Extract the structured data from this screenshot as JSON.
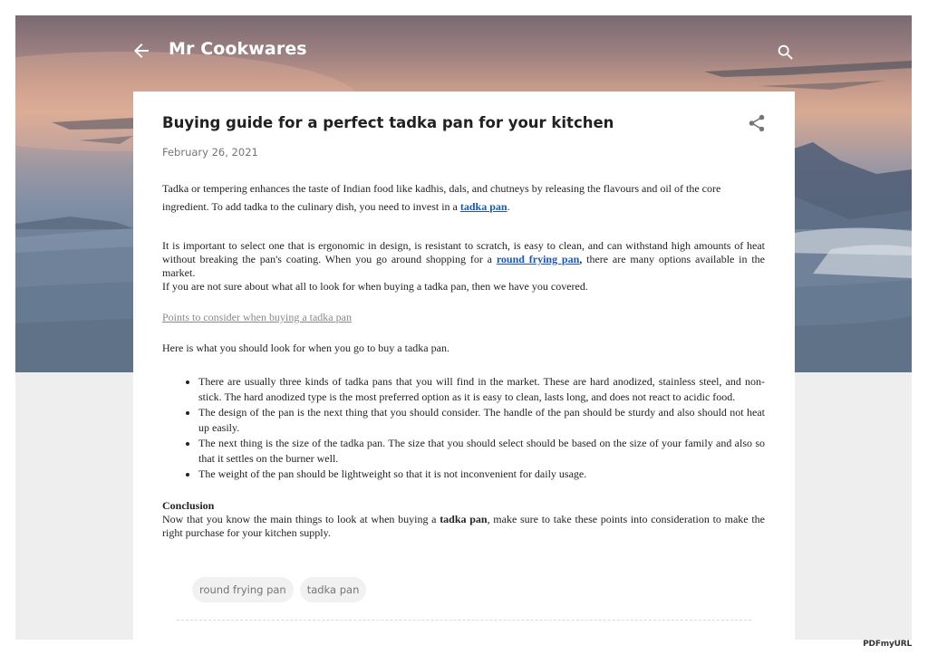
{
  "header": {
    "site_title": "Mr Cookwares",
    "icons": {
      "back": "arrow-left-icon",
      "search": "search-icon"
    }
  },
  "post": {
    "title": "Buying guide for a perfect tadka pan for your kitchen",
    "date": "February 26, 2021",
    "share_icon": "share-icon",
    "p1": {
      "text": "Tadka or tempering enhances the taste of Indian food like kadhis, dals, and chutneys by releasing the flavours and oil of the core ingredient. To add tadka to the culinary dish, you need to invest in a ",
      "link": "tadka pan",
      "end": "."
    },
    "p2": {
      "text": "It is important to select one that is ergonomic in design, is resistant to scratch, is easy to clean, and can withstand high amounts of heat without breaking the pan's coating. When you go around shopping for a ",
      "link": "round frying pan",
      "bold_comma": ",",
      "end": " there are many options available in the market."
    },
    "p3": "If you are not sure about what all to look for when buying a tadka pan, then we have you covered.",
    "subheading": "Points to consider when buying a tadka pan",
    "intro": "Here is what you should look for when you go to buy a tadka pan.",
    "bullets": [
      "There are usually three kinds of tadka pans that you will find in the market. These are hard anodized, stainless steel, and non-stick. The hard anodized type is the most preferred option as it is easy to clean, lasts long, and does not react to acidic food.",
      "The design of the pan is the next thing that you should consider. The handle of the pan should be sturdy and also should not heat up easily.",
      "The next thing is the size of the tadka pan. The size that you should select should be based on the size of your family and also so that it settles on the burner well.",
      "The weight of the pan should be lightweight so that it is not inconvenient for daily usage."
    ],
    "conclusion": {
      "heading": "Conclusion",
      "pre": "Now that you know the main things to look at when buying a ",
      "bold": "tadka pan",
      "post": ", make sure to take these points into consideration to make the right purchase for your kitchen supply."
    },
    "labels": [
      "round frying pan",
      "tadka pan"
    ]
  },
  "watermark": "PDFmyURL",
  "colors": {
    "link": "#1a56b4",
    "page_bg": "#eeeeee",
    "card_bg": "#ffffff",
    "chip_bg": "#f1f1f1"
  }
}
